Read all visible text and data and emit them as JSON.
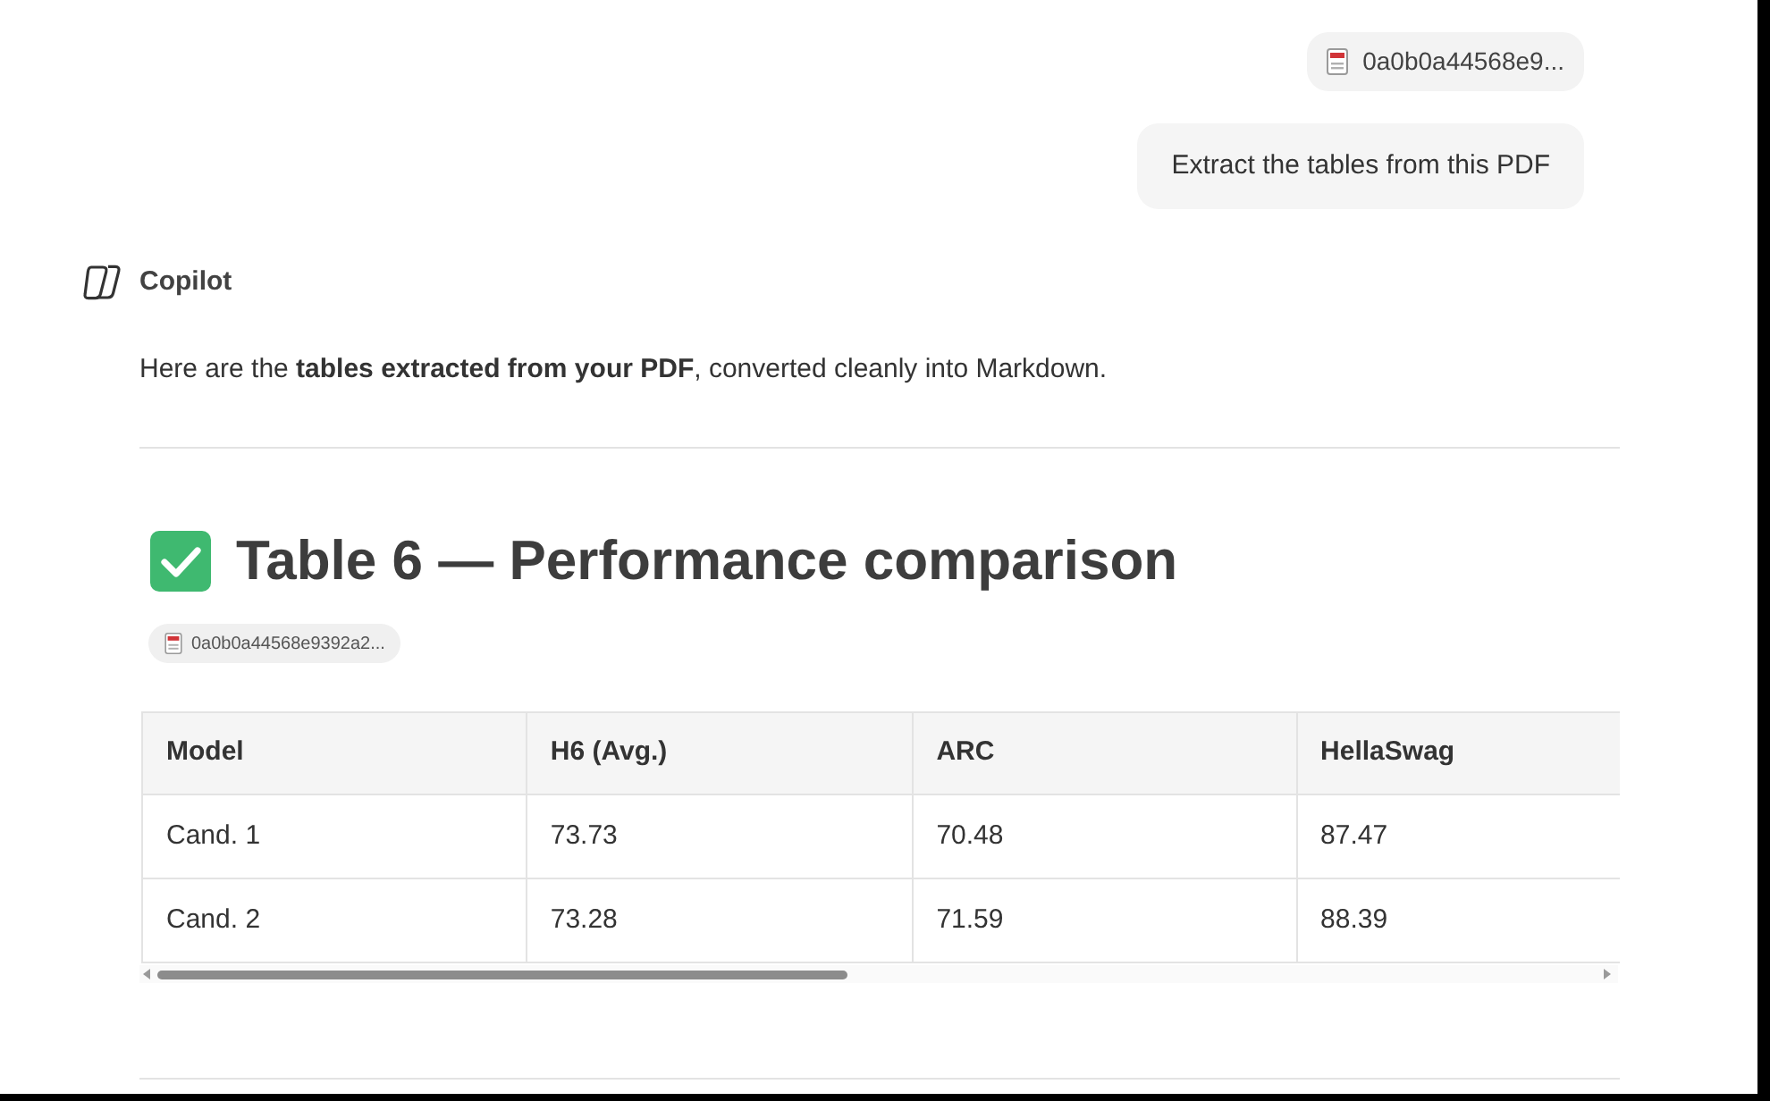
{
  "attachment": {
    "file_name": "0a0b0a44568e9..."
  },
  "user_message": "Extract the tables from this PDF",
  "assistant": {
    "name": "Copilot"
  },
  "response": {
    "intro": "Here are the **tables extracted from your PDF**, converted cleanly into Markdown.",
    "heading": "Table 6 — Performance comparison",
    "source": {
      "file_name": "0a0b0a44568e9392a2..."
    },
    "table": {
      "columns": [
        "Model",
        "H6 (Avg.)",
        "ARC",
        "HellaSwag"
      ],
      "rows": [
        [
          "Cand. 1",
          "73.73",
          "70.48",
          "87.47"
        ],
        [
          "Cand. 2",
          "73.28",
          "71.59",
          "88.39"
        ]
      ]
    }
  }
}
